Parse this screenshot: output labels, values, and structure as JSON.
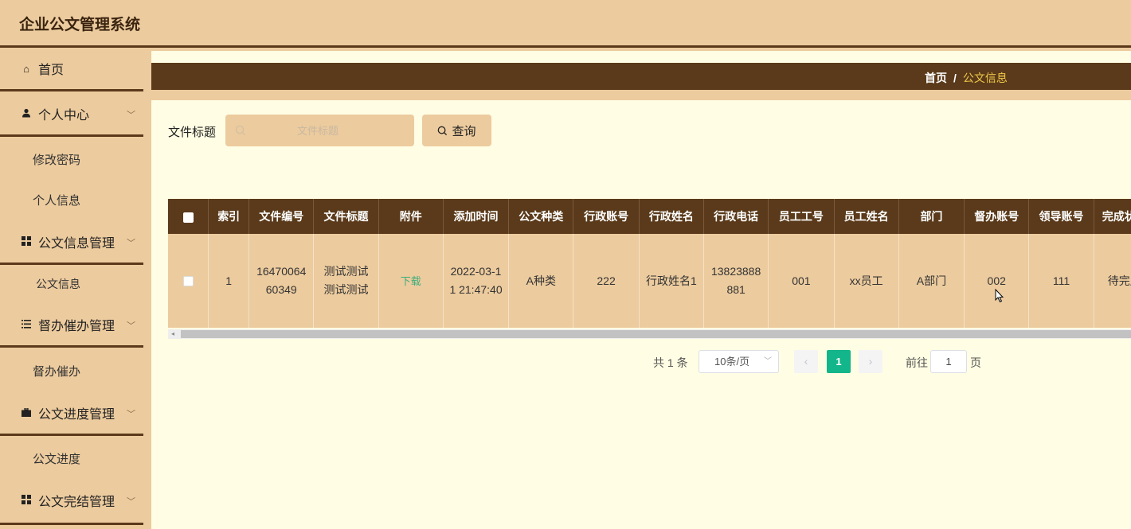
{
  "app": {
    "title": "企业公文管理系统"
  },
  "sidebar": {
    "items": [
      {
        "label": "首页",
        "icon": "home-icon"
      },
      {
        "label": "个人中心",
        "icon": "user-icon",
        "sub": [
          "修改密码",
          "个人信息"
        ]
      },
      {
        "label": "公文信息管理",
        "icon": "grid-icon",
        "sub": [
          "公文信息"
        ]
      },
      {
        "label": "督办催办管理",
        "icon": "list-icon",
        "sub": [
          "督办催办"
        ]
      },
      {
        "label": "公文进度管理",
        "icon": "briefcase-icon",
        "sub": [
          "公文进度"
        ]
      },
      {
        "label": "公文完结管理",
        "icon": "grid-icon"
      }
    ]
  },
  "breadcrumb": {
    "home": "首页",
    "separator": "/",
    "current": "公文信息"
  },
  "search": {
    "label": "文件标题",
    "placeholder": "文件标题",
    "button": "查询"
  },
  "table": {
    "columns": [
      "索引",
      "文件编号",
      "文件标题",
      "附件",
      "添加时间",
      "公文种类",
      "行政账号",
      "行政姓名",
      "行政电话",
      "员工工号",
      "员工姓名",
      "部门",
      "督办账号",
      "领导账号",
      "完成状态"
    ],
    "rows": [
      {
        "index": "1",
        "file_no": "1647006460349",
        "file_title": "测试测试测试测试",
        "attachment": "下载",
        "added_time": "2022-03-11 21:47:40",
        "doc_type": "A种类",
        "admin_account": "222",
        "admin_name": "行政姓名1",
        "admin_phone": "13823888881",
        "staff_no": "001",
        "staff_name": "xx员工",
        "department": "A部门",
        "supervisor_account": "002",
        "leader_account": "111",
        "status": "待完成"
      }
    ]
  },
  "pagination": {
    "total_text": "共 1 条",
    "page_size": "10条/页",
    "current_page": "1",
    "goto_label": "前往",
    "goto_value": "1",
    "page_suffix": "页",
    "prev": "‹",
    "next": "›"
  },
  "colors": {
    "sidebar_bg": "#eccb9e",
    "dark_brown": "#5a3a1a",
    "page_bg": "#fffde3",
    "active_page": "#13b58a"
  }
}
